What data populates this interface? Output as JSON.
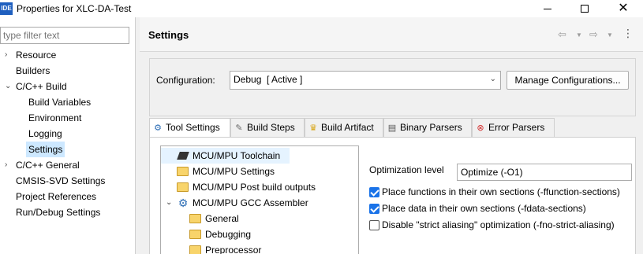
{
  "window": {
    "icon_label": "IDE",
    "title": "Properties for XLC-DA-Test",
    "close_glyph": "✕"
  },
  "sidebar": {
    "filter_placeholder": "type filter text",
    "items": [
      {
        "label": "Resource",
        "expander": "›"
      },
      {
        "label": "Builders"
      },
      {
        "label": "C/C++ Build",
        "expander": "⌄"
      },
      {
        "label": "Build Variables"
      },
      {
        "label": "Environment"
      },
      {
        "label": "Logging"
      },
      {
        "label": "Settings",
        "selected": true
      },
      {
        "label": "C/C++ General",
        "expander": "›"
      },
      {
        "label": "CMSIS-SVD Settings"
      },
      {
        "label": "Project References"
      },
      {
        "label": "Run/Debug Settings"
      }
    ]
  },
  "header": {
    "title": "Settings",
    "back_glyph": "⇦",
    "forward_glyph": "⇨",
    "dropdown_glyph": "▼",
    "menu_glyph": "⋮"
  },
  "configuration": {
    "label": "Configuration:",
    "value": "Debug  [ Active ]",
    "chevron": "⌄",
    "manage_label": "Manage Configurations..."
  },
  "tabs": [
    {
      "label": "Tool Settings",
      "icon": "⚙",
      "active": true
    },
    {
      "label": "Build Steps",
      "icon": "✎"
    },
    {
      "label": "Build Artifact",
      "icon": "♛"
    },
    {
      "label": "Binary Parsers",
      "icon": "▤"
    },
    {
      "label": "Error Parsers",
      "icon": "⊗"
    }
  ],
  "tool_tree": [
    {
      "label": "MCU/MPU Toolchain",
      "icon": "chip-icon",
      "selected": true
    },
    {
      "label": "MCU/MPU Settings",
      "icon": "folder-icon"
    },
    {
      "label": "MCU/MPU Post build outputs",
      "icon": "folder-icon"
    },
    {
      "label": "MCU/MPU GCC Assembler",
      "icon": "gear-icon",
      "expander": "⌄"
    },
    {
      "label": "General",
      "icon": "folder-icon"
    },
    {
      "label": "Debugging",
      "icon": "folder-icon"
    },
    {
      "label": "Preprocessor",
      "icon": "folder-icon"
    }
  ],
  "options": {
    "optimization_label": "Optimization level",
    "optimization_value": "Optimize (-O1)",
    "checks": [
      {
        "label": "Place functions in their own sections (-ffunction-sections)",
        "checked": true
      },
      {
        "label": "Place data in their own sections (-fdata-sections)",
        "checked": true
      },
      {
        "label": "Disable \"strict aliasing\" optimization (-fno-strict-aliasing)",
        "checked": false
      }
    ]
  },
  "colors": {
    "selection": "#cde8ff",
    "checkbox_accent": "#1a73e8",
    "app_icon": "#1f5fbf"
  }
}
